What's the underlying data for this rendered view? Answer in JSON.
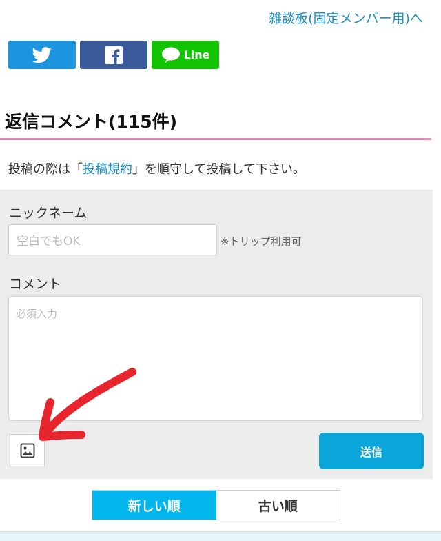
{
  "header": {
    "board_link": "雑談板(固定メンバー用)へ"
  },
  "share": {
    "twitter": {
      "icon": "twitter-bird-icon",
      "color": "#1d95e0"
    },
    "facebook": {
      "icon": "facebook-icon",
      "color": "#3a5a9c"
    },
    "line": {
      "icon": "line-speech-bubble-icon",
      "label": "Line",
      "color": "#11c300"
    }
  },
  "comments": {
    "title": "返信コメント(115件)",
    "accent_color": "#ea8ec2"
  },
  "notice": {
    "prefix": "投稿の際は「",
    "terms_link": "投稿規約",
    "suffix": "」を順守して投稿して下さい。"
  },
  "form": {
    "nickname_label": "ニックネーム",
    "nickname_placeholder": "空白でもOK",
    "trip_note": "※トリップ利用可",
    "comment_label": "コメント",
    "comment_placeholder": "必須入力",
    "image_button_icon": "image-icon",
    "submit_label": "送信",
    "submit_color": "#0aa6d9"
  },
  "annotation": {
    "arrow_icon": "red-arrow-icon",
    "color": "#e8242c"
  },
  "sort": {
    "newest_label": "新しい順",
    "oldest_label": "古い順",
    "active": "newest",
    "active_color": "#00b6ec"
  }
}
